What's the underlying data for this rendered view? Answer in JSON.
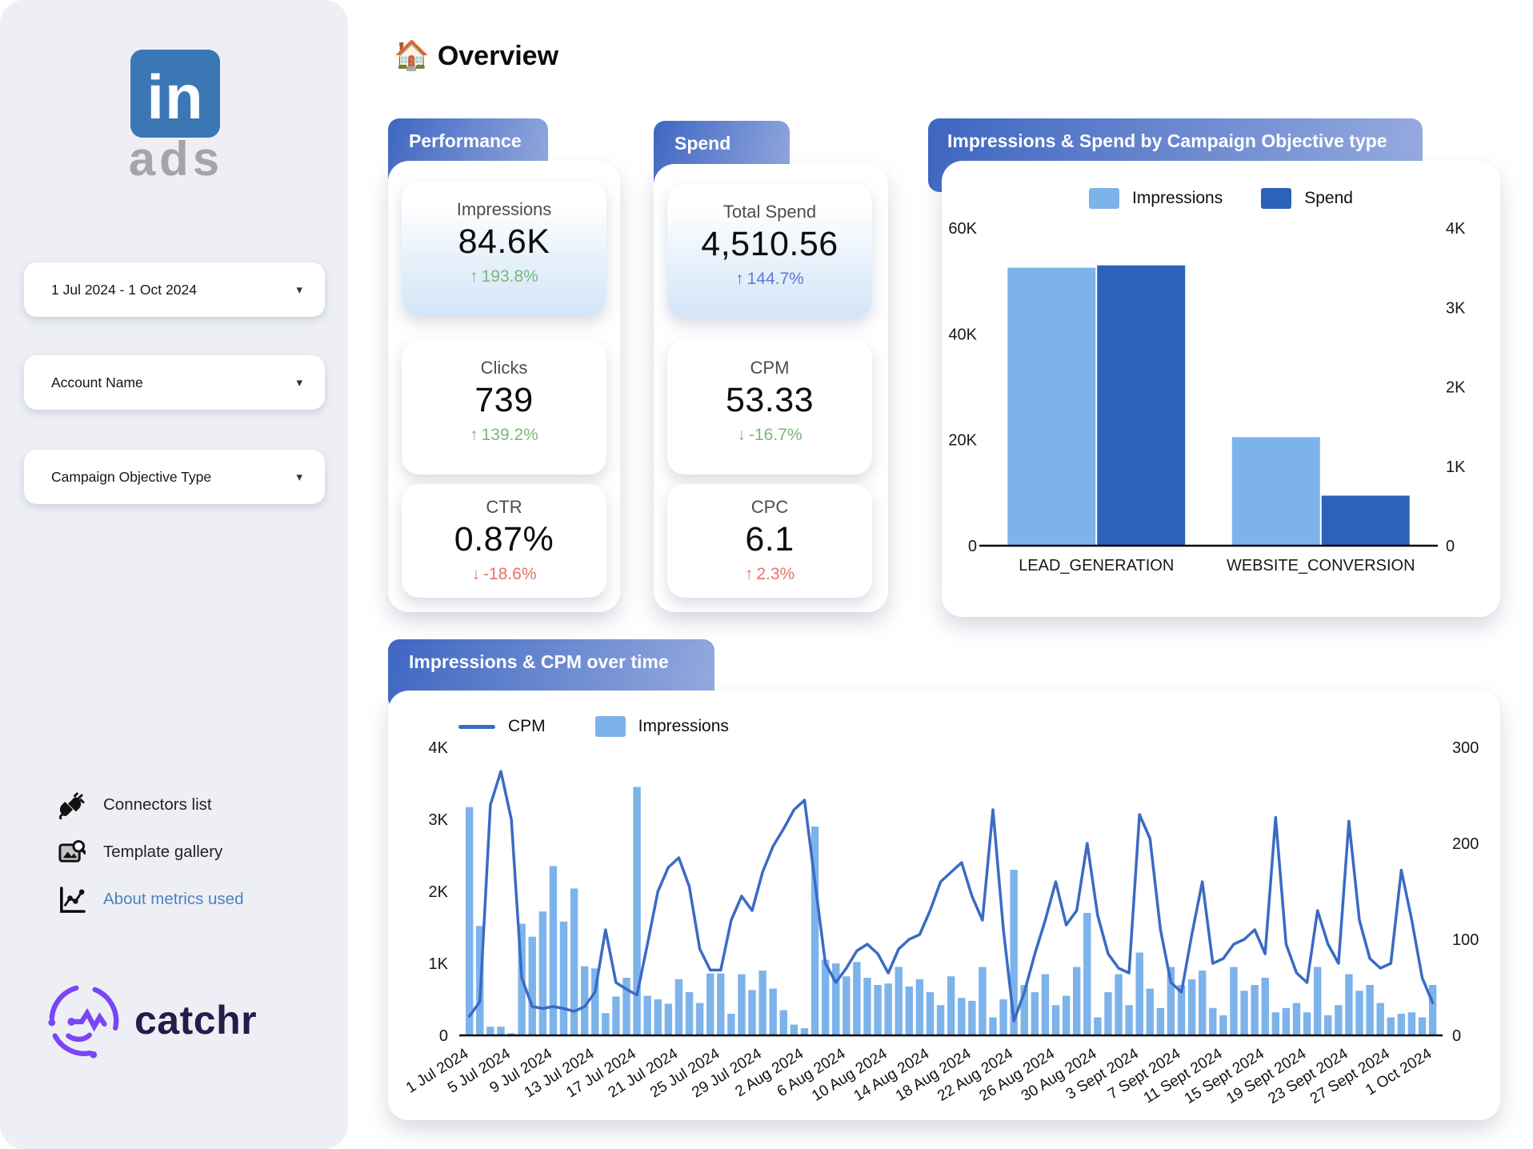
{
  "colors": {
    "tab_start": "#3e66c1",
    "tab_end": "#96abdf",
    "bar_impressions": "#7db3eb",
    "bar_spend": "#2e62b8",
    "line_cpm": "#3a6bc4",
    "delta_green": "#79b878",
    "delta_red": "#e4736b",
    "delta_blue": "#6079d4",
    "linkedin_blue": "#3b76b5",
    "link_blue": "#4e80c0",
    "catchr_purple": "#7b45f6"
  },
  "sidebar": {
    "logo_main": "in",
    "logo_sub": "ads",
    "caret": "▾",
    "filters": [
      {
        "label": "1 Jul 2024 - 1 Oct 2024"
      },
      {
        "label": "Account Name"
      },
      {
        "label": "Campaign Objective Type"
      }
    ],
    "links": [
      {
        "label": "Connectors list"
      },
      {
        "label": "Template gallery"
      },
      {
        "label": "About metrics used"
      }
    ],
    "brand": "catchr"
  },
  "header": {
    "emoji": "🏠",
    "title": "Overview"
  },
  "performance": {
    "title": "Performance",
    "metrics": [
      {
        "label": "Impressions",
        "value": "84.6K",
        "arrow": "↑",
        "delta": "193.8%",
        "color": "#79b878"
      },
      {
        "label": "Clicks",
        "value": "739",
        "arrow": "↑",
        "delta": "139.2%",
        "color": "#79b878"
      },
      {
        "label": "CTR",
        "value": "0.87%",
        "arrow": "↓",
        "delta": "-18.6%",
        "color": "#e4736b"
      }
    ]
  },
  "spend": {
    "title": "Spend",
    "metrics": [
      {
        "label": "Total Spend",
        "value": "4,510.56",
        "arrow": "↑",
        "delta": "144.7%",
        "color": "#6079d4"
      },
      {
        "label": "CPM",
        "value": "53.33",
        "arrow": "↓",
        "delta": "-16.7%",
        "color": "#79b878"
      },
      {
        "label": "CPC",
        "value": "6.1",
        "arrow": "↑",
        "delta": "2.3%",
        "color": "#e4736b"
      }
    ]
  },
  "chart_data": [
    {
      "type": "bar",
      "title": "Impressions & Spend by Campaign Objective type",
      "categories": [
        "LEAD_GENERATION",
        "WEBSITE_CONVERSION"
      ],
      "series": [
        {
          "name": "Impressions",
          "axis": "left",
          "values": [
            52500,
            20500
          ]
        },
        {
          "name": "Spend",
          "axis": "right",
          "values": [
            3530,
            630
          ]
        }
      ],
      "left_axis": {
        "max": 60000,
        "ticks": [
          0,
          20000,
          40000,
          60000
        ],
        "labels": [
          "0",
          "20K",
          "40K",
          "60K"
        ]
      },
      "right_axis": {
        "max": 4000,
        "ticks": [
          0,
          1000,
          2000,
          3000,
          4000
        ],
        "labels": [
          "0",
          "1K",
          "2K",
          "3K",
          "4K"
        ]
      },
      "legend_position": "top",
      "grid": false
    },
    {
      "type": "bar+line",
      "title": "Impressions & CPM over time",
      "x_start": "1 Jul 2024",
      "x_end": "1 Oct 2024",
      "x_tick_day_index": [
        0,
        4,
        8,
        12,
        16,
        20,
        24,
        28,
        32,
        36,
        40,
        44,
        48,
        52,
        56,
        60,
        64,
        68,
        72,
        76,
        80,
        84,
        88,
        92
      ],
      "x_tick_labels": [
        "1 Jul 2024",
        "5 Jul 2024",
        "9 Jul 2024",
        "13 Jul 2024",
        "17 Jul 2024",
        "21 Jul 2024",
        "25 Jul 2024",
        "29 Jul 2024",
        "2 Aug 2024",
        "6 Aug 2024",
        "10 Aug 2024",
        "14 Aug 2024",
        "18 Aug 2024",
        "22 Aug 2024",
        "26 Aug 2024",
        "30 Aug 2024",
        "3 Sept 2024",
        "7 Sept 2024",
        "11 Sept 2024",
        "15 Sept 2024",
        "19 Sept 2024",
        "23 Sept 2024",
        "27 Sept 2024",
        "1 Oct 2024"
      ],
      "series": [
        {
          "name": "CPM",
          "type": "line",
          "axis": "right",
          "values": [
            20,
            35,
            240,
            275,
            225,
            60,
            30,
            28,
            30,
            28,
            25,
            30,
            45,
            110,
            55,
            48,
            42,
            95,
            150,
            175,
            185,
            155,
            90,
            68,
            68,
            120,
            145,
            130,
            170,
            197,
            215,
            235,
            245,
            160,
            75,
            55,
            70,
            88,
            95,
            85,
            65,
            90,
            100,
            105,
            130,
            160,
            170,
            180,
            145,
            120,
            235,
            110,
            15,
            45,
            85,
            120,
            160,
            115,
            130,
            200,
            125,
            85,
            70,
            65,
            230,
            205,
            110,
            55,
            45,
            105,
            160,
            75,
            80,
            95,
            100,
            110,
            85,
            227,
            95,
            65,
            55,
            130,
            95,
            75,
            223,
            120,
            80,
            70,
            75,
            172,
            120,
            60,
            34
          ]
        },
        {
          "name": "Impressions",
          "type": "bar",
          "axis": "left",
          "values": [
            3170,
            1520,
            120,
            120,
            30,
            1550,
            1370,
            1720,
            2350,
            1580,
            2040,
            960,
            930,
            310,
            540,
            800,
            3450,
            550,
            500,
            440,
            780,
            600,
            450,
            860,
            860,
            300,
            850,
            630,
            900,
            650,
            350,
            150,
            100,
            2900,
            1050,
            1000,
            820,
            1020,
            800,
            700,
            720,
            950,
            680,
            780,
            600,
            420,
            820,
            520,
            480,
            950,
            250,
            500,
            2300,
            700,
            600,
            850,
            420,
            550,
            950,
            1700,
            250,
            600,
            850,
            420,
            1150,
            650,
            380,
            950,
            700,
            780,
            900,
            380,
            280,
            950,
            620,
            700,
            800,
            320,
            380,
            450,
            320,
            950,
            280,
            420,
            850,
            620,
            700,
            450,
            250,
            300,
            320,
            250,
            700
          ]
        }
      ],
      "left_axis": {
        "max": 4000,
        "ticks": [
          0,
          1000,
          2000,
          3000,
          4000
        ],
        "labels": [
          "0",
          "1K",
          "2K",
          "3K",
          "4K"
        ]
      },
      "right_axis": {
        "max": 300,
        "ticks": [
          0,
          100,
          200,
          300
        ],
        "labels": [
          "0",
          "100",
          "200",
          "300"
        ]
      },
      "legend_position": "top",
      "grid": false
    }
  ]
}
